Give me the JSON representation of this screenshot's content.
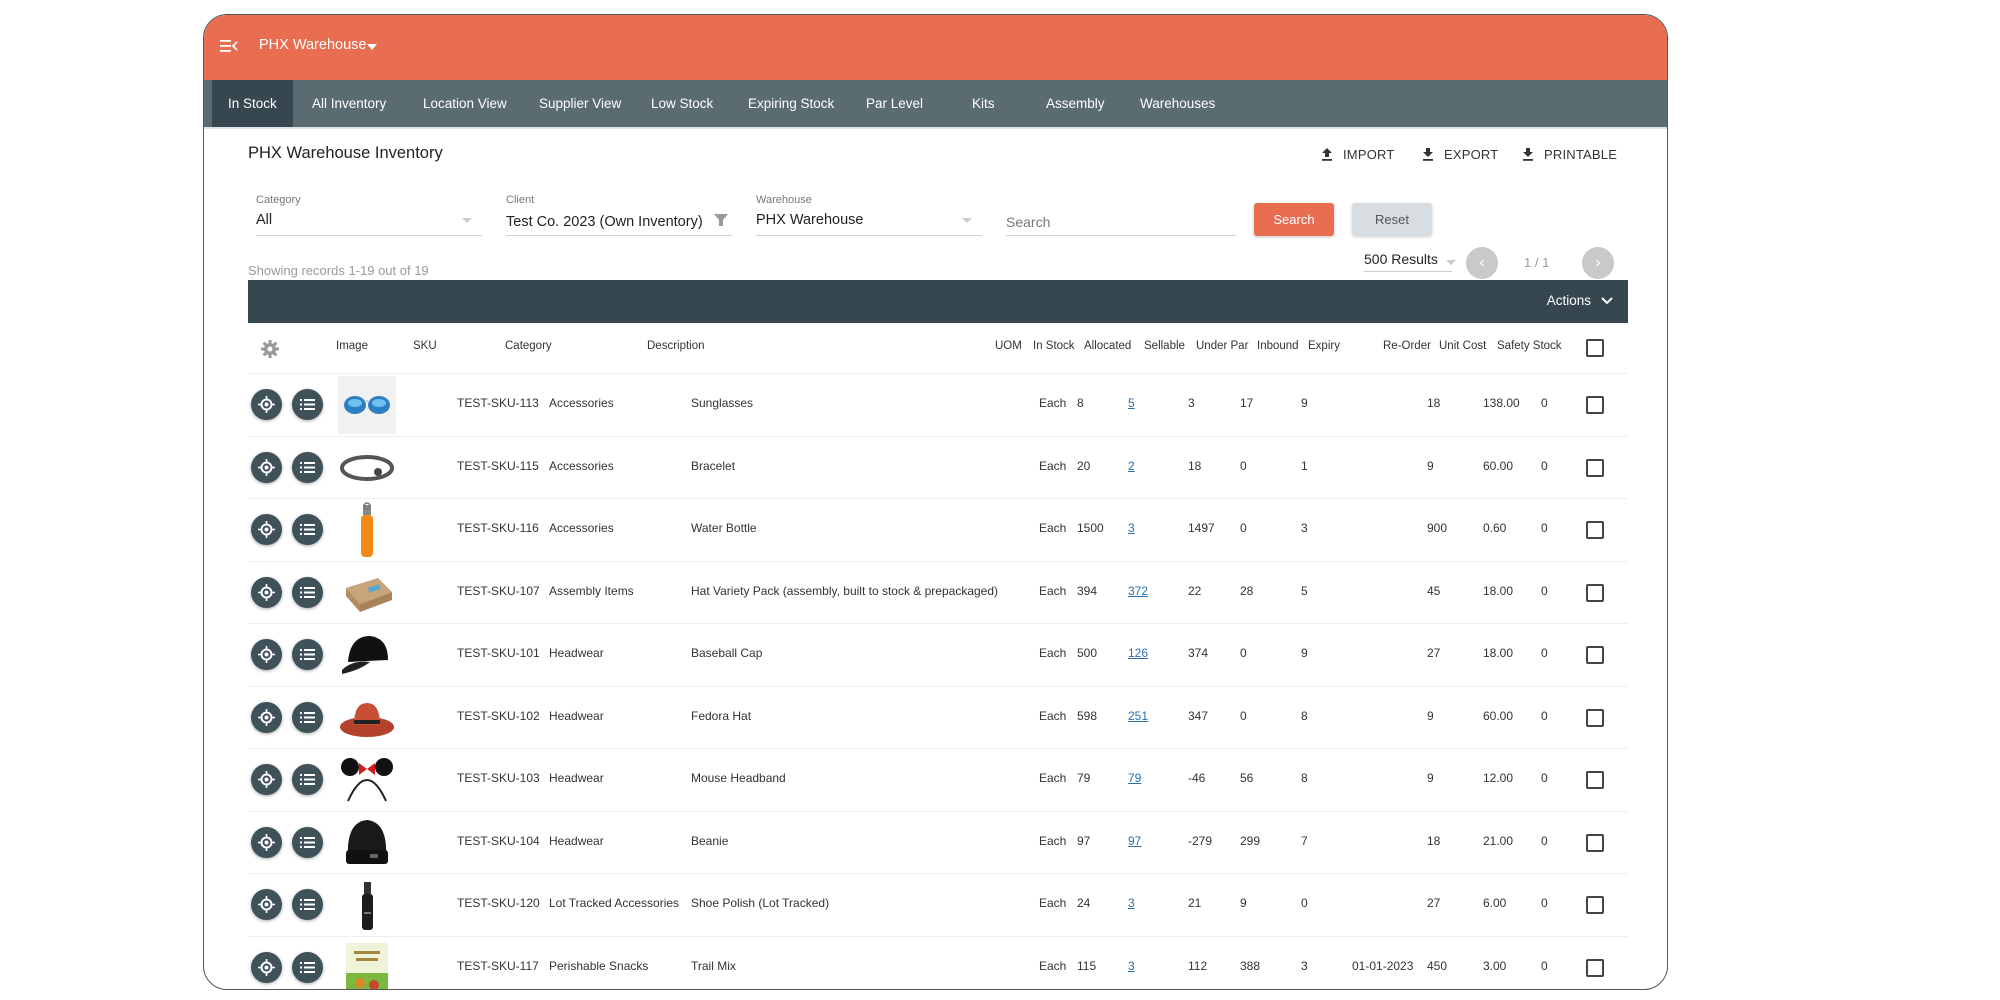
{
  "header": {
    "warehouse_selector": "PHX Warehouse",
    "brand_color": "#e86d51",
    "nav_color": "#5a6b72"
  },
  "nav": {
    "tabs": [
      {
        "label": "In Stock",
        "active": true
      },
      {
        "label": "All Inventory",
        "active": false
      },
      {
        "label": "Location View",
        "active": false
      },
      {
        "label": "Supplier View",
        "active": false
      },
      {
        "label": "Low Stock",
        "active": false
      },
      {
        "label": "Expiring Stock",
        "active": false
      },
      {
        "label": "Par Level",
        "active": false
      },
      {
        "label": "Kits",
        "active": false
      },
      {
        "label": "Assembly",
        "active": false
      },
      {
        "label": "Warehouses",
        "active": false
      }
    ]
  },
  "page": {
    "title": "PHX Warehouse Inventory",
    "import_label": "IMPORT",
    "export_label": "EXPORT",
    "printable_label": "PRINTABLE"
  },
  "filters": {
    "category_label": "Category",
    "category_value": "All",
    "client_label": "Client",
    "client_value": "Test Co. 2023 (Own Inventory)",
    "warehouse_label": "Warehouse",
    "warehouse_value": "PHX Warehouse",
    "search_placeholder": "Search",
    "search_button": "Search",
    "reset_button": "Reset"
  },
  "pagination": {
    "showing": "Showing records 1-19 out of 19",
    "results_per_page": "500 Results",
    "page_indicator": "1 / 1",
    "prev": "‹",
    "next": "›"
  },
  "table": {
    "actions_label": "Actions",
    "columns": [
      "Image",
      "SKU",
      "Category",
      "Description",
      "UOM",
      "In Stock",
      "Allocated",
      "Sellable",
      "Under Par",
      "Inbound",
      "Expiry",
      "Re-Order",
      "Unit Cost",
      "Safety Stock"
    ],
    "rows": [
      {
        "image": "sunglasses",
        "sku": "TEST-SKU-113",
        "category": "Accessories",
        "description": "Sunglasses",
        "uom": "Each",
        "in_stock": "8",
        "allocated": "5",
        "sellable": "3",
        "under_par": "17",
        "inbound": "9",
        "expiry": "",
        "reorder": "18",
        "unit_cost": "138.00",
        "safety_stock": "0"
      },
      {
        "image": "bracelet",
        "sku": "TEST-SKU-115",
        "category": "Accessories",
        "description": "Bracelet",
        "uom": "Each",
        "in_stock": "20",
        "allocated": "2",
        "sellable": "18",
        "under_par": "0",
        "inbound": "1",
        "expiry": "",
        "reorder": "9",
        "unit_cost": "60.00",
        "safety_stock": "0"
      },
      {
        "image": "water-bottle",
        "sku": "TEST-SKU-116",
        "category": "Accessories",
        "description": "Water Bottle",
        "uom": "Each",
        "in_stock": "1500",
        "allocated": "3",
        "sellable": "1497",
        "under_par": "0",
        "inbound": "3",
        "expiry": "",
        "reorder": "900",
        "unit_cost": "0.60",
        "safety_stock": "0"
      },
      {
        "image": "box",
        "sku": "TEST-SKU-107",
        "category": "Assembly Items",
        "description": "Hat Variety Pack (assembly, built to stock & prepackaged)",
        "uom": "Each",
        "in_stock": "394",
        "allocated": "372",
        "sellable": "22",
        "under_par": "28",
        "inbound": "5",
        "expiry": "",
        "reorder": "45",
        "unit_cost": "18.00",
        "safety_stock": "0"
      },
      {
        "image": "baseball-cap",
        "sku": "TEST-SKU-101",
        "category": "Headwear",
        "description": "Baseball Cap",
        "uom": "Each",
        "in_stock": "500",
        "allocated": "126",
        "sellable": "374",
        "under_par": "0",
        "inbound": "9",
        "expiry": "",
        "reorder": "27",
        "unit_cost": "18.00",
        "safety_stock": "0"
      },
      {
        "image": "fedora",
        "sku": "TEST-SKU-102",
        "category": "Headwear",
        "description": "Fedora Hat",
        "uom": "Each",
        "in_stock": "598",
        "allocated": "251",
        "sellable": "347",
        "under_par": "0",
        "inbound": "8",
        "expiry": "",
        "reorder": "9",
        "unit_cost": "60.00",
        "safety_stock": "0"
      },
      {
        "image": "mouse-headband",
        "sku": "TEST-SKU-103",
        "category": "Headwear",
        "description": "Mouse Headband",
        "uom": "Each",
        "in_stock": "79",
        "allocated": "79",
        "sellable": "-46",
        "under_par": "56",
        "inbound": "8",
        "expiry": "",
        "reorder": "9",
        "unit_cost": "12.00",
        "safety_stock": "0"
      },
      {
        "image": "beanie",
        "sku": "TEST-SKU-104",
        "category": "Headwear",
        "description": "Beanie",
        "uom": "Each",
        "in_stock": "97",
        "allocated": "97",
        "sellable": "-279",
        "under_par": "299",
        "inbound": "7",
        "expiry": "",
        "reorder": "18",
        "unit_cost": "21.00",
        "safety_stock": "0"
      },
      {
        "image": "spray-bottle",
        "sku": "TEST-SKU-120",
        "category": "Lot Tracked Accessories",
        "description": "Shoe Polish (Lot Tracked)",
        "uom": "Each",
        "in_stock": "24",
        "allocated": "3",
        "sellable": "21",
        "under_par": "9",
        "inbound": "0",
        "expiry": "",
        "reorder": "27",
        "unit_cost": "6.00",
        "safety_stock": "0"
      },
      {
        "image": "trail-mix-bag",
        "sku": "TEST-SKU-117",
        "category": "Perishable Snacks",
        "description": "Trail Mix",
        "uom": "Each",
        "in_stock": "115",
        "allocated": "3",
        "sellable": "112",
        "under_par": "388",
        "inbound": "3",
        "expiry": "01-01-2023",
        "reorder": "450",
        "unit_cost": "3.00",
        "safety_stock": "0"
      }
    ]
  }
}
